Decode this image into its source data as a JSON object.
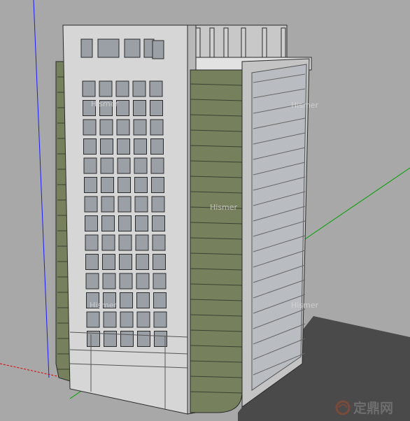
{
  "scene": {
    "colors": {
      "background": "#a8a8a8",
      "shadow": "#4a4a4a",
      "facade_main": "#d6d6d6",
      "facade_side": "#c4c4c4",
      "window": "#9aa0a6",
      "cylinder": "#76805c",
      "glass": "#b9bdc2",
      "axis_blue": "#1a1aff",
      "axis_green": "#00a000",
      "axis_red": "#e00000"
    },
    "watermarks": [
      "Hismer",
      "Hismer",
      "Hismer",
      "Hismer",
      "Hismer"
    ],
    "logo": {
      "text": "定鼎网",
      "icon": "logo-swirl-icon"
    }
  }
}
